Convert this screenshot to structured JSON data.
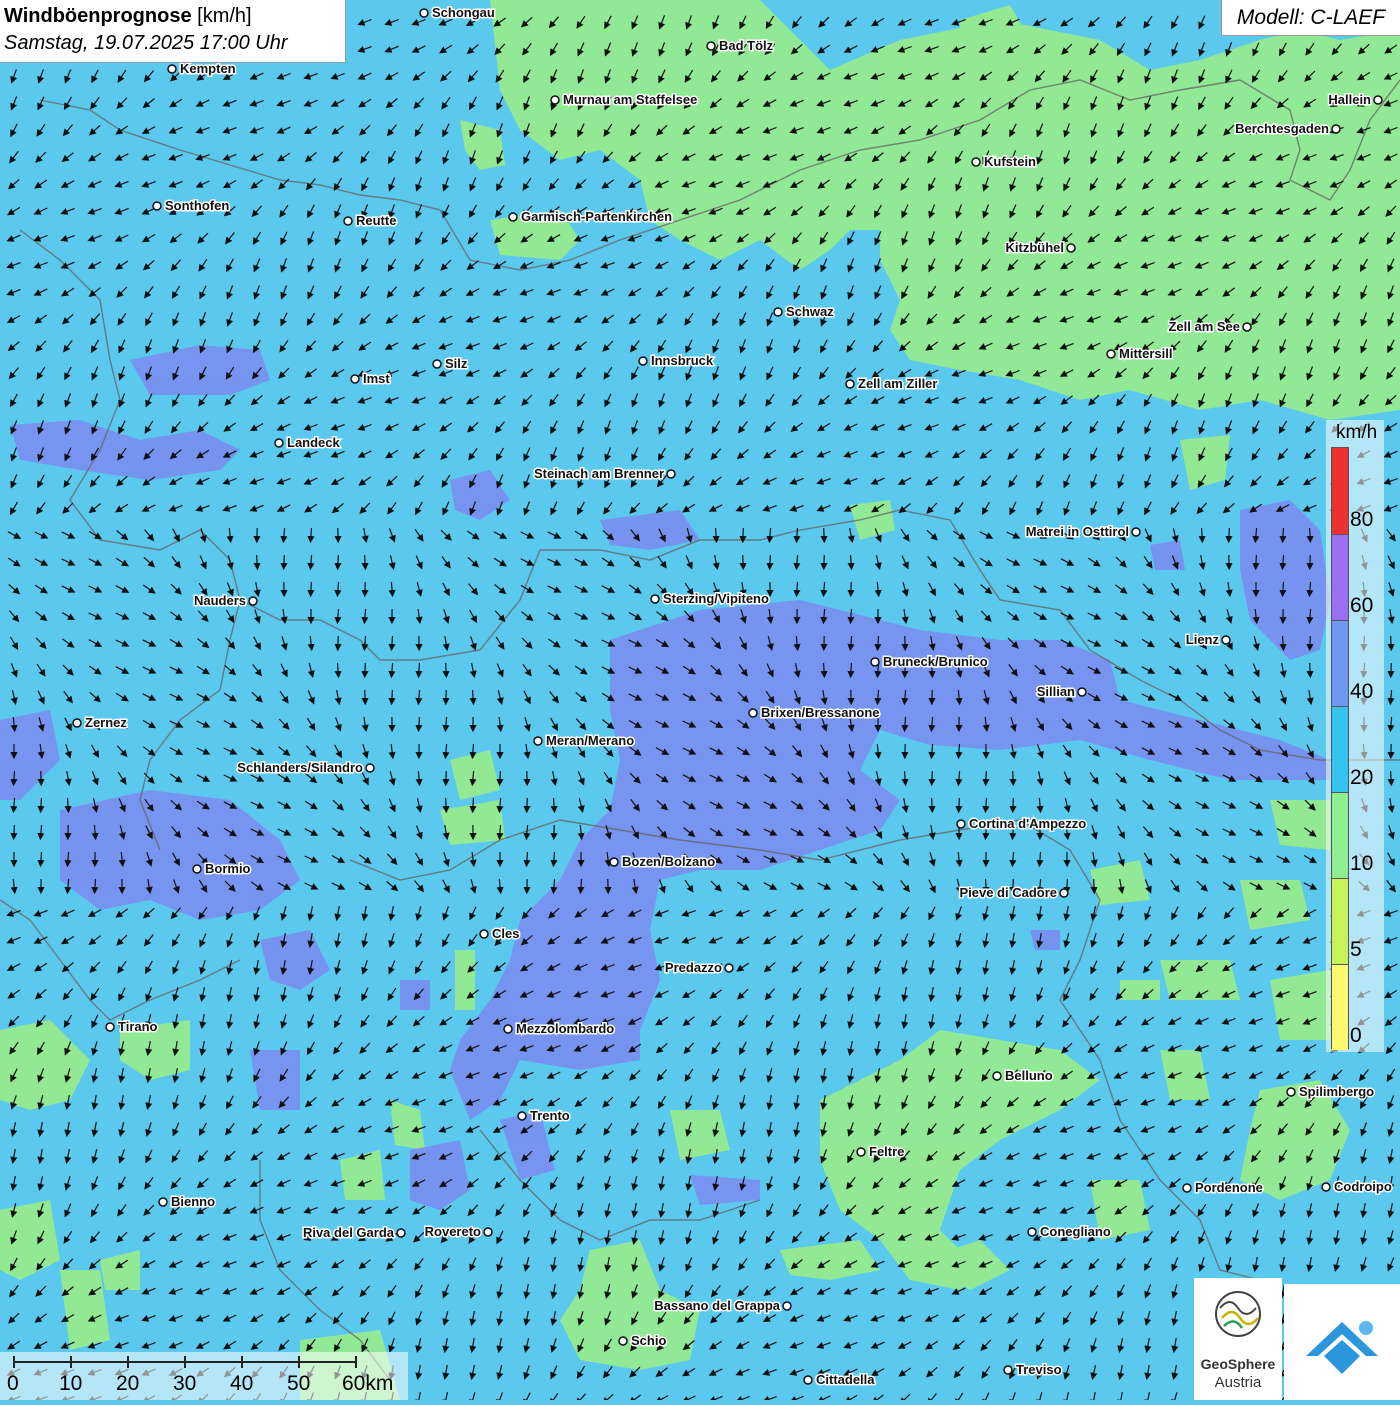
{
  "title": {
    "main": "Windböenprognose",
    "unit": "[km/h]",
    "datetime": "Samstag, 19.07.2025 17:00 Uhr"
  },
  "model": "Modell: C-LAEF",
  "legend": {
    "unit": "km/h",
    "labels": [
      "80",
      "60",
      "40",
      "20",
      "10",
      "5",
      "0"
    ],
    "colors": {
      "above_80": "#ef3030",
      "60_80": "#9b6ef2",
      "40_60": "#6f96f0",
      "20_40": "#35c4f1",
      "10_20": "#8ef090",
      "5_10": "#c8f25a",
      "0_5": "#fbf86e"
    }
  },
  "scale": {
    "labels": [
      "0",
      "10",
      "20",
      "30",
      "40",
      "50",
      "60km"
    ]
  },
  "cities": [
    {
      "name": "Schongau"
    },
    {
      "name": "Bad Tölz"
    },
    {
      "name": "Kempten"
    },
    {
      "name": "Murnau am Staffelsee"
    },
    {
      "name": "Hallein"
    },
    {
      "name": "Berchtesgaden"
    },
    {
      "name": "Kufstein"
    },
    {
      "name": "Sonthofen"
    },
    {
      "name": "Reutte"
    },
    {
      "name": "Garmisch-Partenkirchen"
    },
    {
      "name": "Kitzbühel"
    },
    {
      "name": "Schwaz"
    },
    {
      "name": "Zell am See"
    },
    {
      "name": "Mittersill"
    },
    {
      "name": "Innsbruck"
    },
    {
      "name": "Silz"
    },
    {
      "name": "Imst"
    },
    {
      "name": "Zell am Ziller"
    },
    {
      "name": "Landeck"
    },
    {
      "name": "Steinach am Brenner"
    },
    {
      "name": "Matrei in Osttirol"
    },
    {
      "name": "Nauders"
    },
    {
      "name": "Sterzing/Vipiteno"
    },
    {
      "name": "Lienz"
    },
    {
      "name": "Bruneck/Brunico"
    },
    {
      "name": "Sillian"
    },
    {
      "name": "Zernez"
    },
    {
      "name": "Brixen/Bressanone"
    },
    {
      "name": "Meran/Merano"
    },
    {
      "name": "Schlanders/Silandro"
    },
    {
      "name": "Cortina d'Ampezzo"
    },
    {
      "name": "Bozen/Bolzano"
    },
    {
      "name": "Bormio"
    },
    {
      "name": "Pieve di Cadore"
    },
    {
      "name": "Cles"
    },
    {
      "name": "Predazzo"
    },
    {
      "name": "Tirano"
    },
    {
      "name": "Mezzolombardo"
    },
    {
      "name": "Belluno"
    },
    {
      "name": "Spilimbergo"
    },
    {
      "name": "Trento"
    },
    {
      "name": "Feltre"
    },
    {
      "name": "Pordenone"
    },
    {
      "name": "Codroipo"
    },
    {
      "name": "Bienno"
    },
    {
      "name": "Riva del Garda"
    },
    {
      "name": "Rovereto"
    },
    {
      "name": "Conegliano"
    },
    {
      "name": "Bassano del Grappa"
    },
    {
      "name": "Schio"
    },
    {
      "name": "Treviso"
    },
    {
      "name": "Cittadella"
    }
  ],
  "logos": {
    "geosphere_line1": "GeoSphere",
    "geosphere_line2": "Austria"
  }
}
